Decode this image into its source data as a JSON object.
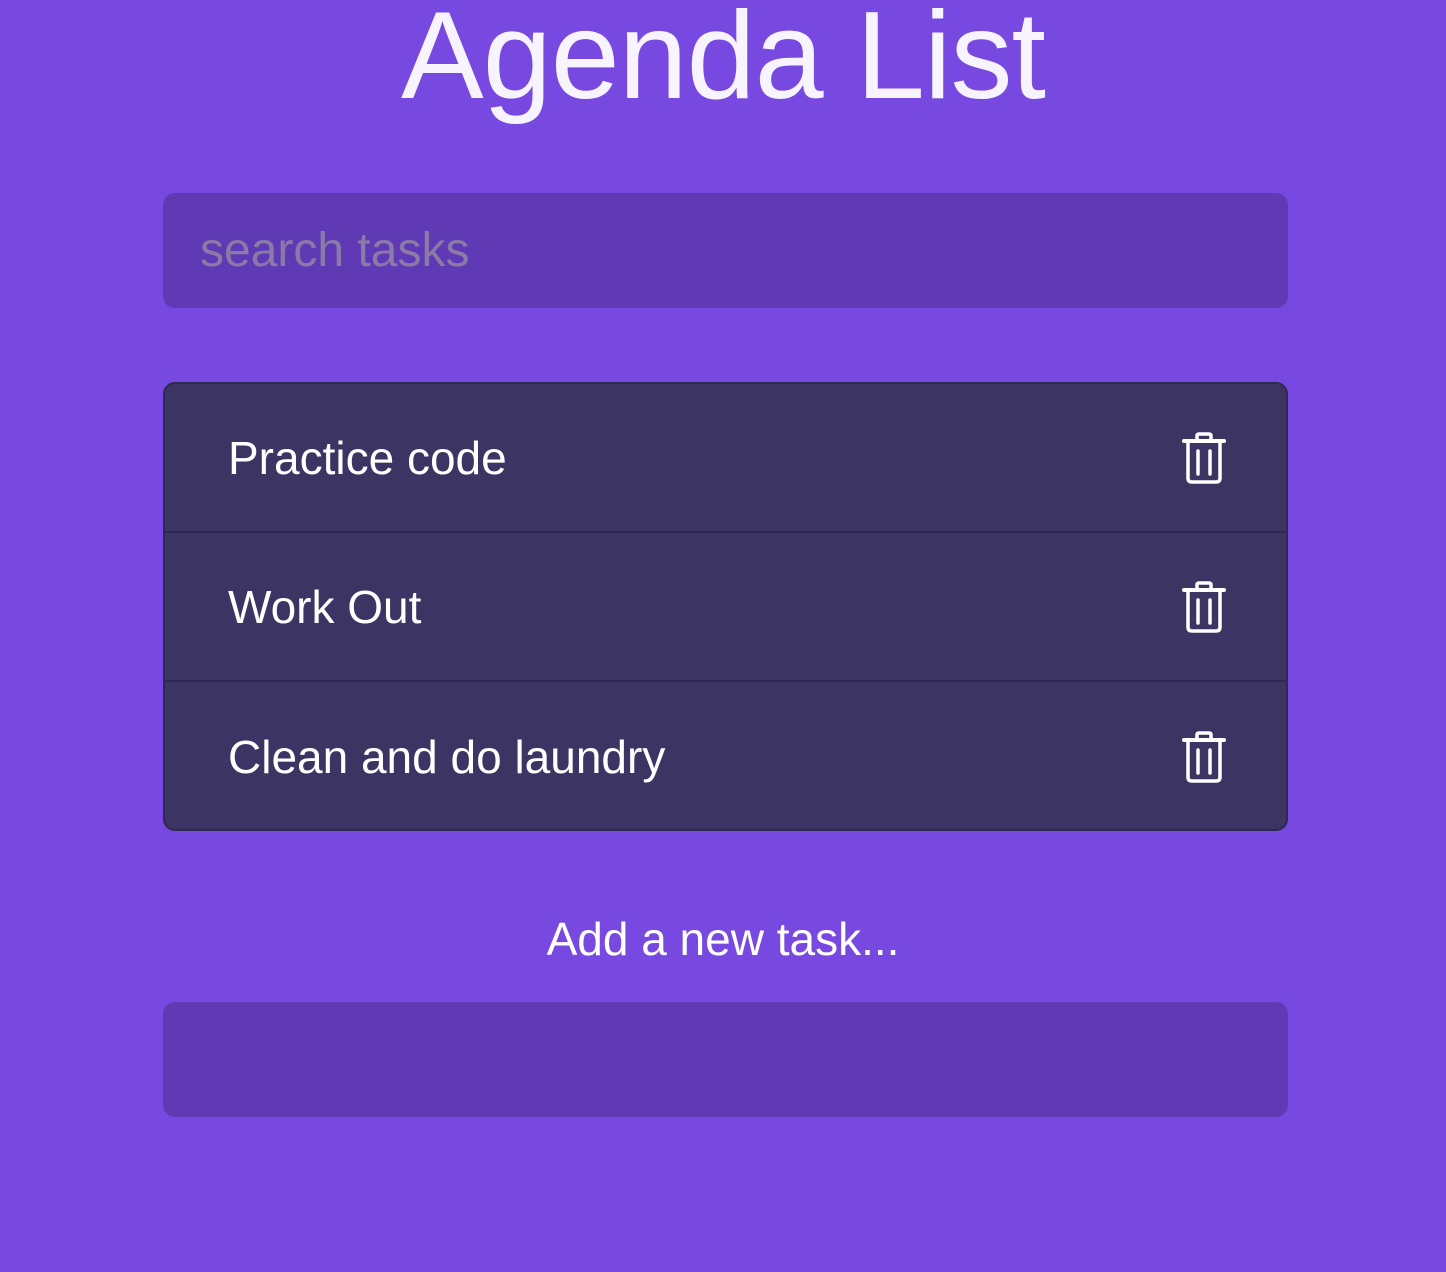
{
  "header": {
    "title": "Agenda List"
  },
  "search": {
    "placeholder": "search tasks",
    "value": ""
  },
  "tasks": [
    {
      "label": "Practice code",
      "icon": "trash-icon"
    },
    {
      "label": "Work Out",
      "icon": "trash-icon"
    },
    {
      "label": "Clean and do laundry",
      "icon": "trash-icon"
    }
  ],
  "add_task": {
    "label": "Add a new task...",
    "value": ""
  },
  "colors": {
    "background": "#7849e0",
    "input_background": "#6039b4",
    "list_background": "#3c3564",
    "text": "#ffffff",
    "placeholder": "#8a7aa8"
  }
}
